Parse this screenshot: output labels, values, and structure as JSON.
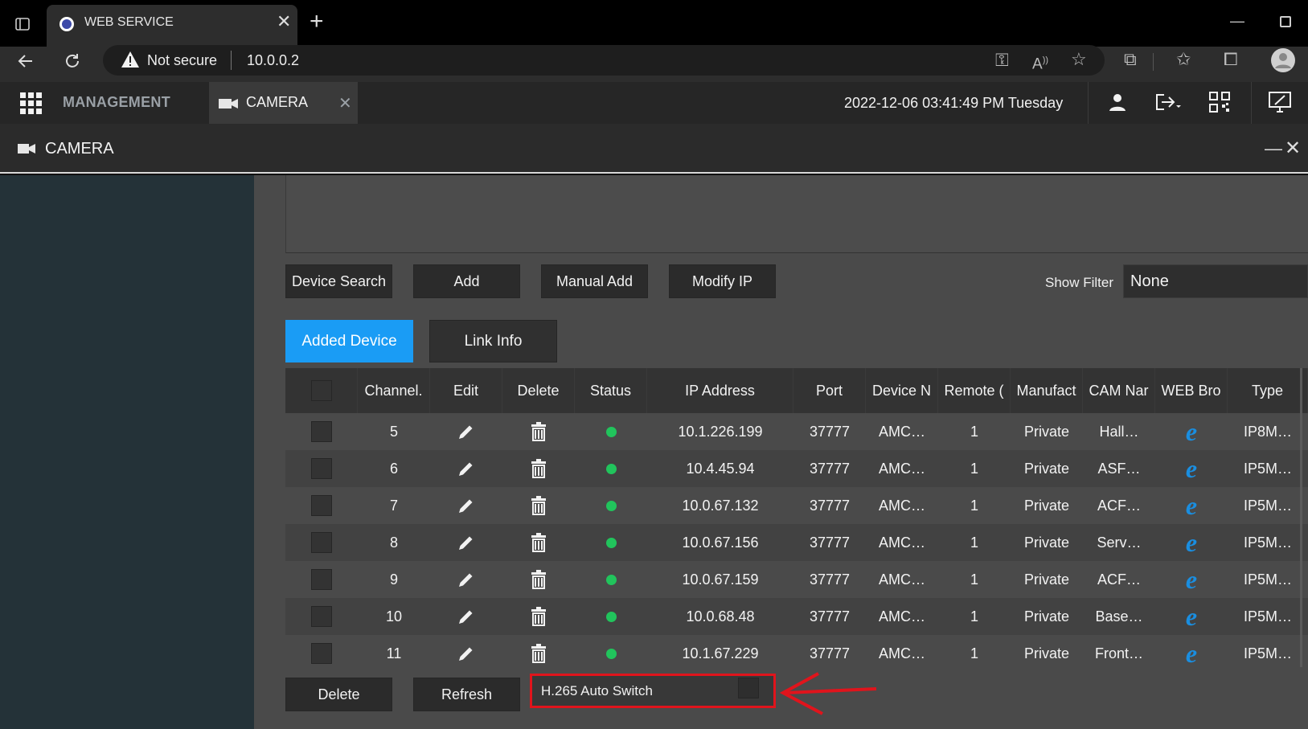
{
  "browser": {
    "tab_title": "WEB SERVICE",
    "security": "Not secure",
    "url": "10.0.0.2"
  },
  "app": {
    "management_label": "MANAGEMENT",
    "camera_tab_label": "CAMERA",
    "datetime": "2022-12-06 03:41:49 PM Tuesday"
  },
  "panel": {
    "title": "CAMERA"
  },
  "toolbar": {
    "device_search": "Device Search",
    "add": "Add",
    "manual_add": "Manual Add",
    "modify_ip": "Modify IP",
    "show_filter_label": "Show Filter",
    "show_filter_value": "None"
  },
  "subtabs": {
    "added_device": "Added Device",
    "link_info": "Link Info"
  },
  "table": {
    "headers": {
      "channel": "Channel.",
      "edit": "Edit",
      "delete": "Delete",
      "status": "Status",
      "ip": "IP Address",
      "port": "Port",
      "device": "Device N",
      "remote": "Remote (",
      "manufacturer": "Manufact",
      "cam_name": "CAM Nar",
      "web": "WEB Bro",
      "type": "Type"
    },
    "rows": [
      {
        "channel": "5",
        "ip": "10.1.226.199",
        "port": "37777",
        "device": "AMC…",
        "remote": "1",
        "manufacturer": "Private",
        "cam_name": "Hall…",
        "type": "IP8M…"
      },
      {
        "channel": "6",
        "ip": "10.4.45.94",
        "port": "37777",
        "device": "AMC…",
        "remote": "1",
        "manufacturer": "Private",
        "cam_name": "ASF…",
        "type": "IP5M…"
      },
      {
        "channel": "7",
        "ip": "10.0.67.132",
        "port": "37777",
        "device": "AMC…",
        "remote": "1",
        "manufacturer": "Private",
        "cam_name": "ACF…",
        "type": "IP5M…"
      },
      {
        "channel": "8",
        "ip": "10.0.67.156",
        "port": "37777",
        "device": "AMC…",
        "remote": "1",
        "manufacturer": "Private",
        "cam_name": "Serv…",
        "type": "IP5M…"
      },
      {
        "channel": "9",
        "ip": "10.0.67.159",
        "port": "37777",
        "device": "AMC…",
        "remote": "1",
        "manufacturer": "Private",
        "cam_name": "ACF…",
        "type": "IP5M…"
      },
      {
        "channel": "10",
        "ip": "10.0.68.48",
        "port": "37777",
        "device": "AMC…",
        "remote": "1",
        "manufacturer": "Private",
        "cam_name": "Base…",
        "type": "IP5M…"
      },
      {
        "channel": "11",
        "ip": "10.1.67.229",
        "port": "37777",
        "device": "AMC…",
        "remote": "1",
        "manufacturer": "Private",
        "cam_name": "Front…",
        "type": "IP5M…"
      }
    ]
  },
  "footer": {
    "delete": "Delete",
    "refresh": "Refresh",
    "h265_label": "H.265 Auto Switch"
  },
  "colors": {
    "accent": "#1a9cf5",
    "status_online": "#21c45c",
    "highlight": "#e0141c"
  }
}
